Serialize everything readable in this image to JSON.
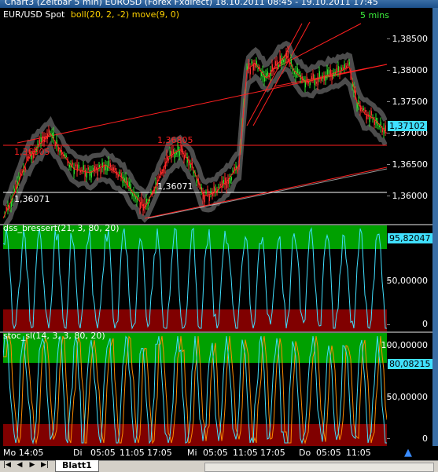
{
  "window": {
    "title": "Chart3 (Zeitbar 5 min) EUROSD (Forex Fxdirect) 18.10.2011 08:45 - 19.10.2011 17:45"
  },
  "price_panel": {
    "title_symbol": "EUR/USD Spot",
    "title_indicators": "boll(20, 2, -2) move(9, 0)",
    "timeframe": "5 mins",
    "current_value": "1,37102",
    "y_ticks": [
      "1,38500",
      "1,38000",
      "1,37500",
      "1,37000",
      "1,36500",
      "1,36000"
    ],
    "levels": [
      {
        "label": "1,36805",
        "value": 1.36805,
        "color": "#ff2020"
      },
      {
        "label": "1,36071",
        "value": 1.36071,
        "color": "#ffffff"
      }
    ],
    "level_labels": {
      "red_left": "1,36805",
      "red_mid": "1,36805",
      "white_mid": "1,36071",
      "white_left": "1,36071"
    },
    "colors": {
      "candle_up": "#30e030",
      "candle_down": "#ff3030",
      "bands": "#8a8a8a",
      "trendline": "#ff2020"
    }
  },
  "dss_panel": {
    "title": "dss_bressert(21, 3, 80, 20)",
    "current_value": "95,82047",
    "y_ticks": [
      "50,00000",
      "0"
    ],
    "colors": {
      "line": "#40e0ff",
      "upper_zone": "#00a000",
      "lower_zone": "#800000"
    }
  },
  "stoc_panel": {
    "title": "stoc_sl(14, 3, 3, 80, 20)",
    "current_value": "80,08215",
    "y_ticks": [
      "100,00000",
      "50,00000",
      "0"
    ],
    "colors": {
      "line": "#40e0ff",
      "signal": "#ff8c00",
      "upper_zone": "#00a000",
      "lower_zone": "#800000"
    }
  },
  "x_axis": {
    "labels": [
      "Mo 14:05",
      "Di",
      "05:05",
      "11:05",
      "17:05",
      "Mi",
      "05:05",
      "11:05",
      "17:05",
      "Do",
      "05:05",
      "11:05"
    ]
  },
  "tabs": {
    "sheet_name": "Blatt1"
  }
}
